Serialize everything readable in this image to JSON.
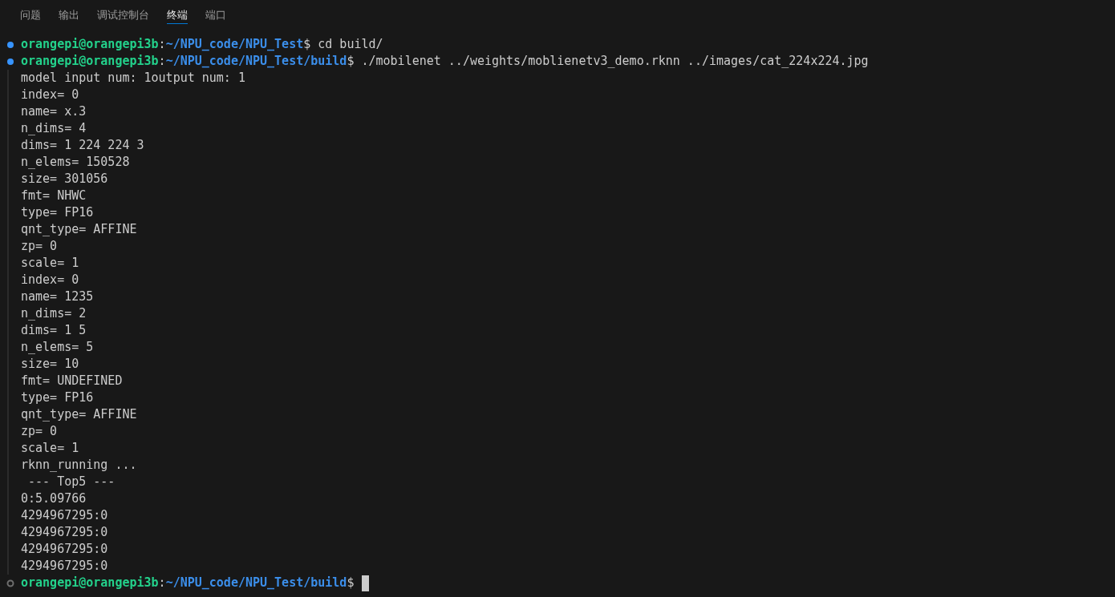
{
  "tabs": [
    {
      "label": "问题",
      "selected": false
    },
    {
      "label": "输出",
      "selected": false
    },
    {
      "label": "调试控制台",
      "selected": false
    },
    {
      "label": "终端",
      "selected": true
    },
    {
      "label": "端口",
      "selected": false
    }
  ],
  "terminal": {
    "blocks": [
      {
        "kind": "prompt",
        "finished": true,
        "user": "orangepi@orangepi3b",
        "sep": ":",
        "path": "~/NPU_code/NPU_Test",
        "symbol": "$",
        "command": " cd build/",
        "cursor": false
      },
      {
        "kind": "prompt",
        "finished": true,
        "user": "orangepi@orangepi3b",
        "sep": ":",
        "path": "~/NPU_code/NPU_Test/build",
        "symbol": "$",
        "command": " ./mobilenet ../weights/moblienetv3_demo.rknn ../images/cat_224x224.jpg",
        "cursor": false
      },
      {
        "kind": "output",
        "lines": [
          "model input num: 1output num: 1",
          "index= 0",
          "name= x.3",
          "n_dims= 4",
          "dims= 1 224 224 3",
          "n_elems= 150528",
          "size= 301056",
          "fmt= NHWC",
          "type= FP16",
          "qnt_type= AFFINE",
          "zp= 0",
          "scale= 1",
          "index= 0",
          "name= 1235",
          "n_dims= 2",
          "dims= 1 5",
          "n_elems= 5",
          "size= 10",
          "fmt= UNDEFINED",
          "type= FP16",
          "qnt_type= AFFINE",
          "zp= 0",
          "scale= 1",
          "rknn_running ...",
          " --- Top5 ---",
          "0:5.09766",
          "4294967295:0",
          "4294967295:0",
          "4294967295:0",
          "4294967295:0"
        ]
      },
      {
        "kind": "prompt",
        "finished": false,
        "user": "orangepi@orangepi3b",
        "sep": ":",
        "path": "~/NPU_code/NPU_Test/build",
        "symbol": "$",
        "cursor": true
      }
    ]
  }
}
